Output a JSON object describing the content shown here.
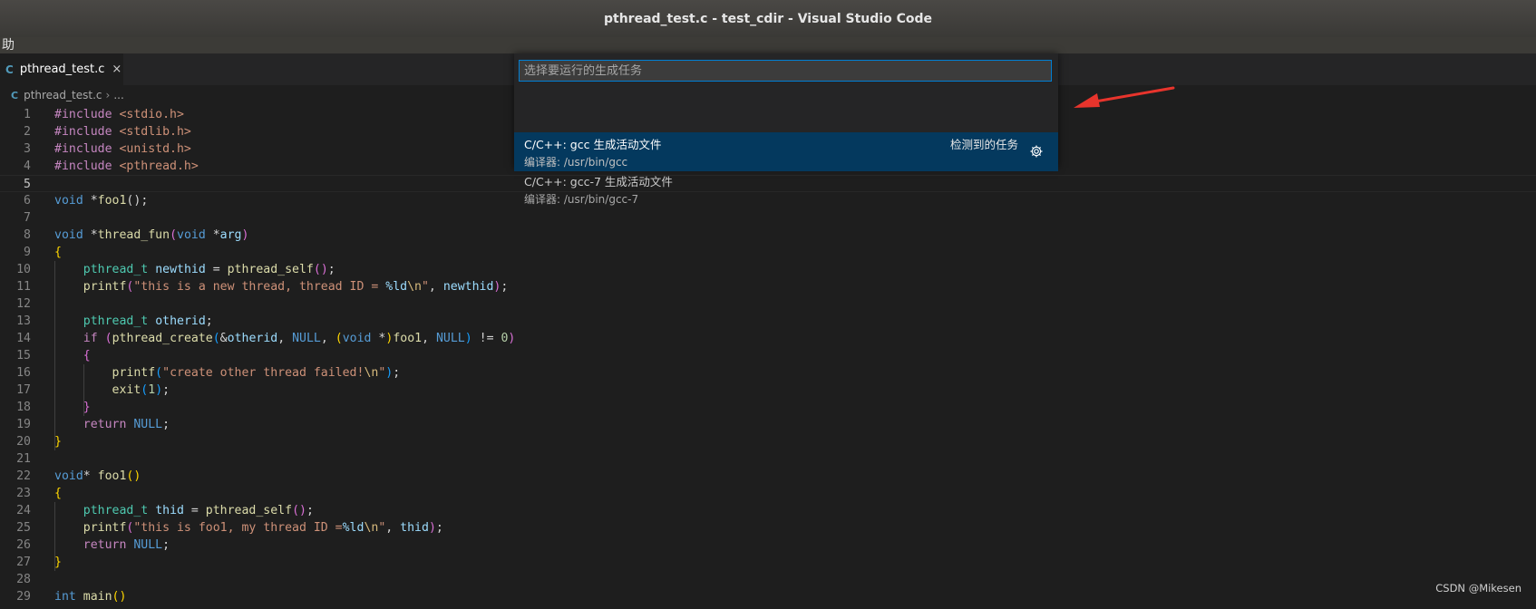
{
  "window": {
    "title": "pthread_test.c - test_cdir - Visual Studio Code"
  },
  "menubar": {
    "visible_text": "助"
  },
  "tab": {
    "icon_text": "C",
    "label": "pthread_test.c",
    "close_glyph": "×"
  },
  "breadcrumb": {
    "icon_text": "C",
    "file": "pthread_test.c",
    "separator": "›",
    "more": "..."
  },
  "quick_pick": {
    "placeholder": "选择要运行的生成任务",
    "items": [
      {
        "label": "C/C++: gcc 生成活动文件",
        "detail": "编译器: /usr/bin/gcc",
        "description": "检测到的任务",
        "icon": "gear-icon",
        "selected": true
      },
      {
        "label": "C/C++: gcc-7 生成活动文件",
        "detail": "编译器: /usr/bin/gcc-7",
        "selected": false
      }
    ]
  },
  "editor": {
    "current_line": 5,
    "line_numbers": [
      "1",
      "2",
      "3",
      "4",
      "5",
      "6",
      "7",
      "8",
      "9",
      "10",
      "11",
      "12",
      "13",
      "14",
      "15",
      "16",
      "17",
      "18",
      "19",
      "20",
      "21",
      "22",
      "23",
      "24",
      "25",
      "26",
      "27",
      "28",
      "29"
    ],
    "lines": [
      [
        [
          "#include ",
          "pp"
        ],
        [
          "<stdio.h>",
          "inc"
        ]
      ],
      [
        [
          "#include ",
          "pp"
        ],
        [
          "<stdlib.h>",
          "inc"
        ]
      ],
      [
        [
          "#include ",
          "pp"
        ],
        [
          "<unistd.h>",
          "inc"
        ]
      ],
      [
        [
          "#include ",
          "pp"
        ],
        [
          "<pthread.h>",
          "inc"
        ]
      ],
      [],
      [
        [
          "void",
          "kw"
        ],
        [
          " *",
          ""
        ],
        [
          "foo1",
          "fn"
        ],
        [
          "()",
          ""
        ],
        [
          ";",
          ""
        ]
      ],
      [],
      [
        [
          "void",
          "kw"
        ],
        [
          " *",
          ""
        ],
        [
          "thread_fun",
          "fn"
        ],
        [
          "(",
          "b2"
        ],
        [
          "void",
          "kw"
        ],
        [
          " *",
          ""
        ],
        [
          "arg",
          "var"
        ],
        [
          ")",
          "b2"
        ]
      ],
      [
        [
          "{",
          "b1"
        ]
      ],
      [
        [
          "    ",
          ""
        ],
        [
          "pthread_t",
          "ty"
        ],
        [
          " ",
          ""
        ],
        [
          "newthid",
          "var"
        ],
        [
          " = ",
          ""
        ],
        [
          "pthread_self",
          "fn"
        ],
        [
          "()",
          "b2"
        ],
        [
          ";",
          ""
        ]
      ],
      [
        [
          "    ",
          ""
        ],
        [
          "printf",
          "fn"
        ],
        [
          "(",
          "b2"
        ],
        [
          "\"this is a new thread, thread ID = ",
          "str"
        ],
        [
          "%ld",
          "var"
        ],
        [
          "\\n",
          "esc"
        ],
        [
          "\"",
          "str"
        ],
        [
          ", ",
          ""
        ],
        [
          "newthid",
          "var"
        ],
        [
          ")",
          "b2"
        ],
        [
          ";",
          ""
        ]
      ],
      [],
      [
        [
          "    ",
          ""
        ],
        [
          "pthread_t",
          "ty"
        ],
        [
          " ",
          ""
        ],
        [
          "otherid",
          "var"
        ],
        [
          ";",
          ""
        ]
      ],
      [
        [
          "    ",
          ""
        ],
        [
          "if",
          "ctl"
        ],
        [
          " ",
          ""
        ],
        [
          "(",
          "b2"
        ],
        [
          "pthread_create",
          "fn"
        ],
        [
          "(",
          "b3"
        ],
        [
          "&",
          ""
        ],
        [
          "otherid",
          "var"
        ],
        [
          ", ",
          ""
        ],
        [
          "NULL",
          "kw"
        ],
        [
          ", ",
          ""
        ],
        [
          "(",
          "b1"
        ],
        [
          "void",
          "kw"
        ],
        [
          " *",
          ""
        ],
        [
          ")",
          "b1"
        ],
        [
          "foo1",
          "fn"
        ],
        [
          ", ",
          ""
        ],
        [
          "NULL",
          "kw"
        ],
        [
          ")",
          "b3"
        ],
        [
          " != ",
          ""
        ],
        [
          "0",
          "num"
        ],
        [
          ")",
          "b2"
        ]
      ],
      [
        [
          "    ",
          ""
        ],
        [
          "{",
          "b2"
        ]
      ],
      [
        [
          "        ",
          ""
        ],
        [
          "printf",
          "fn"
        ],
        [
          "(",
          "b3"
        ],
        [
          "\"create other thread failed!",
          "str"
        ],
        [
          "\\n",
          "esc"
        ],
        [
          "\"",
          "str"
        ],
        [
          ")",
          "b3"
        ],
        [
          ";",
          ""
        ]
      ],
      [
        [
          "        ",
          ""
        ],
        [
          "exit",
          "fn"
        ],
        [
          "(",
          "b3"
        ],
        [
          "1",
          "num"
        ],
        [
          ")",
          "b3"
        ],
        [
          ";",
          ""
        ]
      ],
      [
        [
          "    ",
          ""
        ],
        [
          "}",
          "b2"
        ]
      ],
      [
        [
          "    ",
          ""
        ],
        [
          "return",
          "ctl"
        ],
        [
          " ",
          ""
        ],
        [
          "NULL",
          "kw"
        ],
        [
          ";",
          ""
        ]
      ],
      [
        [
          "}",
          "b1"
        ]
      ],
      [],
      [
        [
          "void",
          "kw"
        ],
        [
          "* ",
          ""
        ],
        [
          "foo1",
          "fn"
        ],
        [
          "()",
          "b1"
        ]
      ],
      [
        [
          "{",
          "b1"
        ]
      ],
      [
        [
          "    ",
          ""
        ],
        [
          "pthread_t",
          "ty"
        ],
        [
          " ",
          ""
        ],
        [
          "thid",
          "var"
        ],
        [
          " = ",
          ""
        ],
        [
          "pthread_self",
          "fn"
        ],
        [
          "()",
          "b2"
        ],
        [
          ";",
          ""
        ]
      ],
      [
        [
          "    ",
          ""
        ],
        [
          "printf",
          "fn"
        ],
        [
          "(",
          "b2"
        ],
        [
          "\"this is foo1, my thread ID =",
          "str"
        ],
        [
          "%ld",
          "var"
        ],
        [
          "\\n",
          "esc"
        ],
        [
          "\"",
          "str"
        ],
        [
          ", ",
          ""
        ],
        [
          "thid",
          "var"
        ],
        [
          ")",
          "b2"
        ],
        [
          ";",
          ""
        ]
      ],
      [
        [
          "    ",
          ""
        ],
        [
          "return",
          "ctl"
        ],
        [
          " ",
          ""
        ],
        [
          "NULL",
          "kw"
        ],
        [
          ";",
          ""
        ]
      ],
      [
        [
          "}",
          "b1"
        ]
      ],
      [],
      [
        [
          "int",
          "kw"
        ],
        [
          " ",
          ""
        ],
        [
          "main",
          "fn"
        ],
        [
          "()",
          "b1"
        ]
      ]
    ]
  },
  "watermark": "CSDN @Mikesen",
  "colors": {
    "accent": "#007fd4",
    "selection": "#04395e",
    "arrow": "#e8342c"
  }
}
